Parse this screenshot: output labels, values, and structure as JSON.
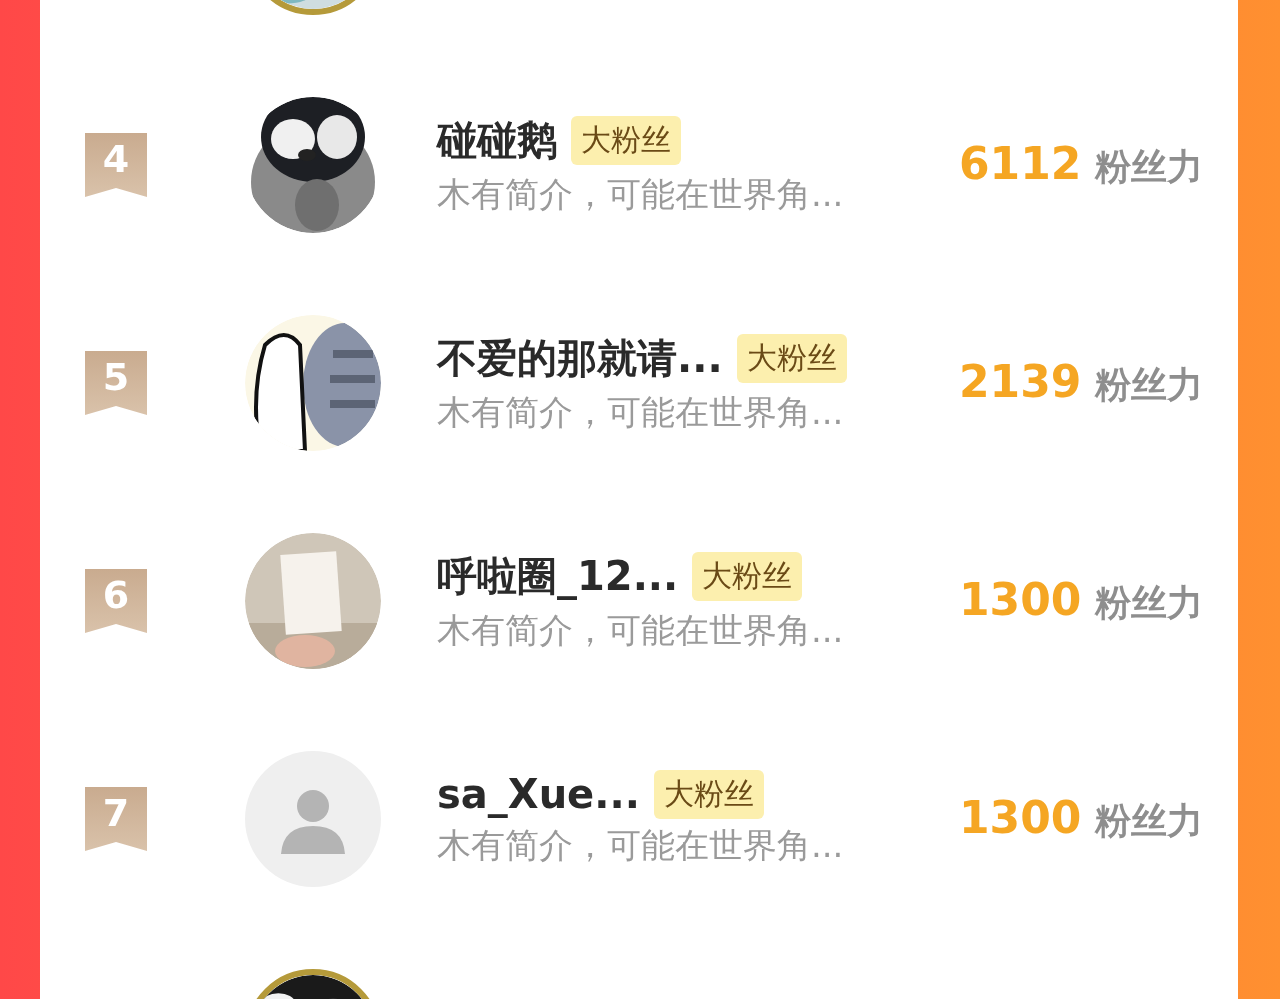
{
  "rows": [
    {
      "kind": "clipped"
    },
    {
      "kind": "full",
      "rank": "4",
      "name": "碰碰鹅",
      "badge": "大粉丝",
      "bio": "木有简介，可能在世界角...",
      "score": "6112",
      "unit": "粉丝力"
    },
    {
      "kind": "full",
      "rank": "5",
      "name": "不爱的那就请...",
      "badge": "大粉丝",
      "bio": "木有简介，可能在世界角...",
      "score": "2139",
      "unit": "粉丝力"
    },
    {
      "kind": "full",
      "rank": "6",
      "name": "呼啦圈_12...",
      "badge": "大粉丝",
      "bio": "木有简介，可能在世界角...",
      "score": "1300",
      "unit": "粉丝力"
    },
    {
      "kind": "full",
      "rank": "7",
      "name": "sa_Xue...",
      "badge": "大粉丝",
      "bio": "木有简介，可能在世界角...",
      "score": "1300",
      "unit": "粉丝力",
      "avatar": {
        "kind": "default"
      }
    },
    {
      "kind": "clipped"
    }
  ]
}
